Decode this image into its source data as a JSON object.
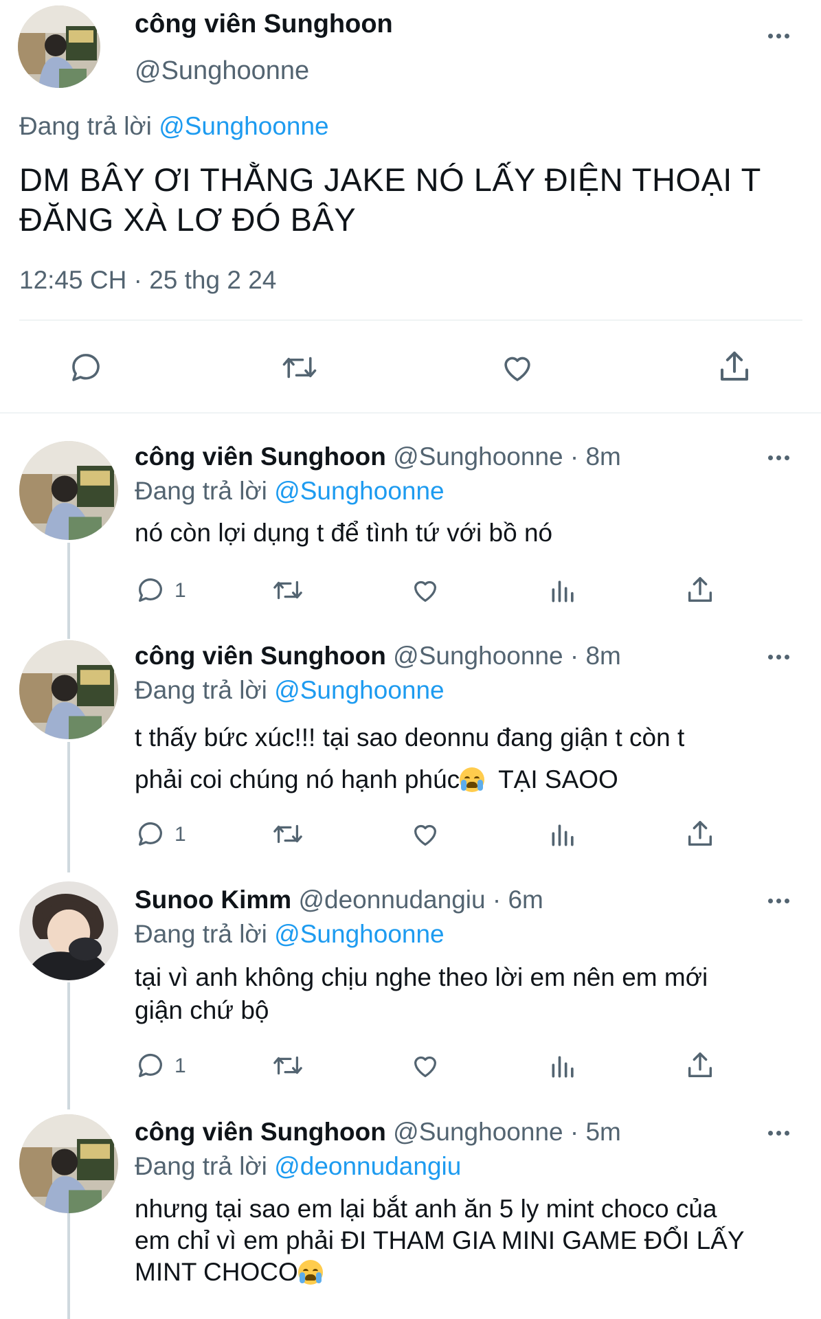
{
  "main_tweet": {
    "display_name": "công viên Sunghoon",
    "handle": "@Sunghoonne",
    "reply_prefix": "Đang trả lời",
    "reply_to": "@Sunghoonne",
    "text_line1": "DM BÂY ƠI THẰNG JAKE NÓ LẤY ĐIỆN THOẠI T",
    "text_line2": "ĐĂNG XÀ LƠ ĐÓ BÂY",
    "timestamp": "12:45 CH · 25 thg 2 24"
  },
  "replies": [
    {
      "display_name": "công viên Sunghoon",
      "handle": "@Sunghoonne",
      "time": " · 8m",
      "reply_prefix": "Đang trả lời",
      "reply_to": "@Sunghoonne",
      "text": " nó còn lợi dụng t để tình tứ với bồ nó",
      "reply_count": "1"
    },
    {
      "display_name": "công viên Sunghoon",
      "handle": "@Sunghoonne",
      "time": " · 8m",
      "reply_prefix": "Đang trả lời",
      "reply_to": "@Sunghoonne",
      "text_line1": "t thấy bức xúc!!! tại sao deonnu đang giận t còn t",
      "text_line2a": "phải coi chúng nó hạnh phúc",
      "text_line2b": "  TẠI SAOO",
      "reply_count": "1"
    },
    {
      "display_name": "Sunoo Kimm",
      "handle": "@deonnudangiu",
      "time": " · 6m",
      "reply_prefix": "Đang trả lời",
      "reply_to": "@Sunghoonne",
      "text_line1": "tại vì anh không chịu nghe theo lời em nên em mới",
      "text_line2": "giận chứ bộ",
      "reply_count": "1"
    },
    {
      "display_name": "công viên Sunghoon",
      "handle": "@Sunghoonne",
      "time": " · 5m",
      "reply_prefix": "Đang trả lời",
      "reply_to": "@deonnudangiu",
      "text_line1": "nhưng tại sao em lại bắt anh ăn 5 ly mint choco của",
      "text_line2": "em chỉ vì em phải ĐI THAM GIA MINI GAME ĐỔI LẤY",
      "text_line3": "MINT CHOCO"
    }
  ],
  "colors": {
    "link": "#1d9bf0",
    "secondary_text": "#536471",
    "primary_text": "#0f1419",
    "divider": "#eff3f4",
    "thread_line": "#cfd9de"
  },
  "icons": [
    "more-icon",
    "reply-icon",
    "retweet-icon",
    "like-icon",
    "share-icon",
    "views-icon",
    "loudly-crying-emoji"
  ]
}
